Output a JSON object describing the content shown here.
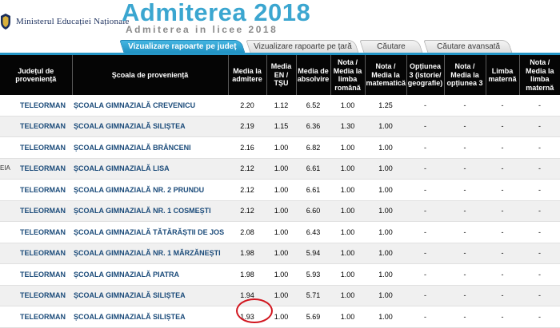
{
  "header": {
    "ministry": "Ministerul Educației Naționale",
    "title": "Admiterea 2018",
    "subtitle": "Admiterea in licee 2018",
    "logo_icon": "crest-icon"
  },
  "tabs": [
    {
      "label": "Vizualizare rapoarte pe județ",
      "active": true
    },
    {
      "label": "Vizualizare rapoarte pe țară",
      "active": false
    },
    {
      "label": "Căutare",
      "active": false
    },
    {
      "label": "Căutare avansată",
      "active": false
    }
  ],
  "table": {
    "headers": [
      "Județul de proveniență",
      "Școala de proveniență",
      "Media la admitere",
      "Media EN / TȘU",
      "Media de absolvire",
      "Nota / Media la limba română",
      "Nota / Media la matematică",
      "Opțiunea 3 (istorie/ geografie)",
      "Nota / Media la opțiunea 3",
      "Limba maternă",
      "Nota / Media la limba maternă"
    ],
    "rows": [
      {
        "stub": "",
        "county": "TELEORMAN",
        "school": "ȘCOALA GIMNAZIALĂ CREVENICU",
        "admitere": "2.20",
        "en": "1.12",
        "absolvire": "6.52",
        "romana": "1.00",
        "matematica": "1.25",
        "opt3": "-",
        "nota_opt3": "-",
        "limba_materna": "-",
        "nota_materna": "-"
      },
      {
        "stub": "",
        "county": "TELEORMAN",
        "school": "ȘCOALA GIMNAZIALĂ SILIȘTEA",
        "admitere": "2.19",
        "en": "1.15",
        "absolvire": "6.36",
        "romana": "1.30",
        "matematica": "1.00",
        "opt3": "-",
        "nota_opt3": "-",
        "limba_materna": "-",
        "nota_materna": "-"
      },
      {
        "stub": "",
        "county": "TELEORMAN",
        "school": "ȘCOALA GIMNAZIALĂ BRÂNCENI",
        "admitere": "2.16",
        "en": "1.00",
        "absolvire": "6.82",
        "romana": "1.00",
        "matematica": "1.00",
        "opt3": "-",
        "nota_opt3": "-",
        "limba_materna": "-",
        "nota_materna": "-"
      },
      {
        "stub": "EIA",
        "county": "TELEORMAN",
        "school": "ȘCOALA GIMNAZIALĂ LISA",
        "admitere": "2.12",
        "en": "1.00",
        "absolvire": "6.61",
        "romana": "1.00",
        "matematica": "1.00",
        "opt3": "-",
        "nota_opt3": "-",
        "limba_materna": "-",
        "nota_materna": "-"
      },
      {
        "stub": "",
        "county": "TELEORMAN",
        "school": "ȘCOALA GIMNAZIALĂ NR. 2 PRUNDU",
        "admitere": "2.12",
        "en": "1.00",
        "absolvire": "6.61",
        "romana": "1.00",
        "matematica": "1.00",
        "opt3": "-",
        "nota_opt3": "-",
        "limba_materna": "-",
        "nota_materna": "-"
      },
      {
        "stub": "",
        "county": "TELEORMAN",
        "school": "ȘCOALA GIMNAZIALĂ NR. 1 COSMEȘTI",
        "admitere": "2.12",
        "en": "1.00",
        "absolvire": "6.60",
        "romana": "1.00",
        "matematica": "1.00",
        "opt3": "-",
        "nota_opt3": "-",
        "limba_materna": "-",
        "nota_materna": "-"
      },
      {
        "stub": "",
        "county": "TELEORMAN",
        "school": "ȘCOALA GIMNAZIALĂ TĂTĂRĂȘTII DE JOS",
        "admitere": "2.08",
        "en": "1.00",
        "absolvire": "6.43",
        "romana": "1.00",
        "matematica": "1.00",
        "opt3": "-",
        "nota_opt3": "-",
        "limba_materna": "-",
        "nota_materna": "-"
      },
      {
        "stub": "",
        "county": "TELEORMAN",
        "school": "ȘCOALA GIMNAZIALĂ NR. 1 MĂRZĂNEȘTI",
        "admitere": "1.98",
        "en": "1.00",
        "absolvire": "5.94",
        "romana": "1.00",
        "matematica": "1.00",
        "opt3": "-",
        "nota_opt3": "-",
        "limba_materna": "-",
        "nota_materna": "-"
      },
      {
        "stub": "",
        "county": "TELEORMAN",
        "school": "ȘCOALA GIMNAZIALĂ PIATRA",
        "admitere": "1.98",
        "en": "1.00",
        "absolvire": "5.93",
        "romana": "1.00",
        "matematica": "1.00",
        "opt3": "-",
        "nota_opt3": "-",
        "limba_materna": "-",
        "nota_materna": "-"
      },
      {
        "stub": "",
        "county": "TELEORMAN",
        "school": "ȘCOALA GIMNAZIALĂ SILIȘTEA",
        "admitere": "1.94",
        "en": "1.00",
        "absolvire": "5.71",
        "romana": "1.00",
        "matematica": "1.00",
        "opt3": "-",
        "nota_opt3": "-",
        "limba_materna": "-",
        "nota_materna": "-"
      },
      {
        "stub": "",
        "county": "TELEORMAN",
        "school": "ȘCOALA GIMNAZIALĂ SILIȘTEA",
        "admitere": "1.93",
        "en": "1.00",
        "absolvire": "5.69",
        "romana": "1.00",
        "matematica": "1.00",
        "opt3": "-",
        "nota_opt3": "-",
        "limba_materna": "-",
        "nota_materna": "-"
      }
    ]
  },
  "annotation": {
    "highlight_color": "#d1161f",
    "highlight_row": 10,
    "highlight_column": "admitere"
  }
}
